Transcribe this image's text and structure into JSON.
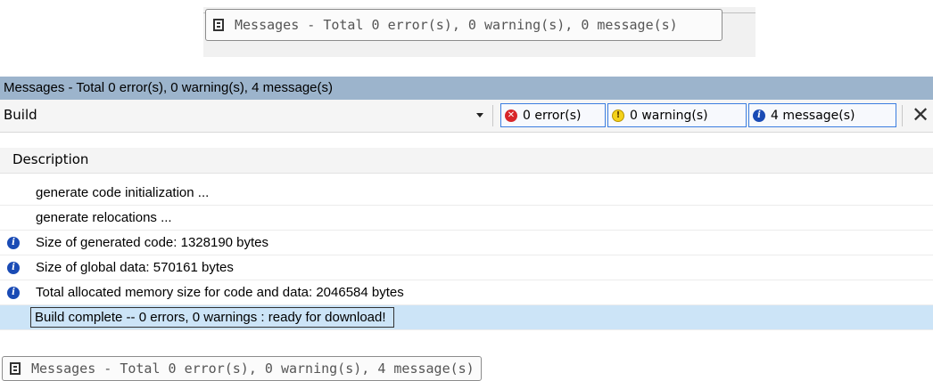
{
  "top_tab": {
    "label": "Messages - Total 0 error(s), 0 warning(s), 0 message(s)"
  },
  "panel": {
    "title": "Messages - Total 0 error(s), 0 warning(s), 4 message(s)",
    "scope_selector": {
      "value": "Build"
    },
    "filters": {
      "errors": "0 error(s)",
      "warnings": "0 warning(s)",
      "messages": "4 message(s)"
    },
    "column_header": "Description",
    "rows": [
      {
        "icon": "none",
        "text": "generate code initialization ..."
      },
      {
        "icon": "none",
        "text": "generate relocations ..."
      },
      {
        "icon": "info-icon",
        "text": "Size of generated code: 1328190 bytes"
      },
      {
        "icon": "info-icon",
        "text": "Size of global data: 570161 bytes"
      },
      {
        "icon": "info-icon",
        "text": "Total allocated memory size for code and data: 2046584 bytes"
      },
      {
        "icon": "none",
        "text": "Build complete -- 0 errors, 0 warnings : ready for download!",
        "selected": true
      }
    ]
  },
  "bottom_tab": {
    "label": "Messages - Total 0 error(s), 0 warning(s), 4 message(s)"
  },
  "colors": {
    "title_bar": "#9cb4cc",
    "selected_row": "#cce4f7",
    "filter_border": "#3b7de0"
  }
}
